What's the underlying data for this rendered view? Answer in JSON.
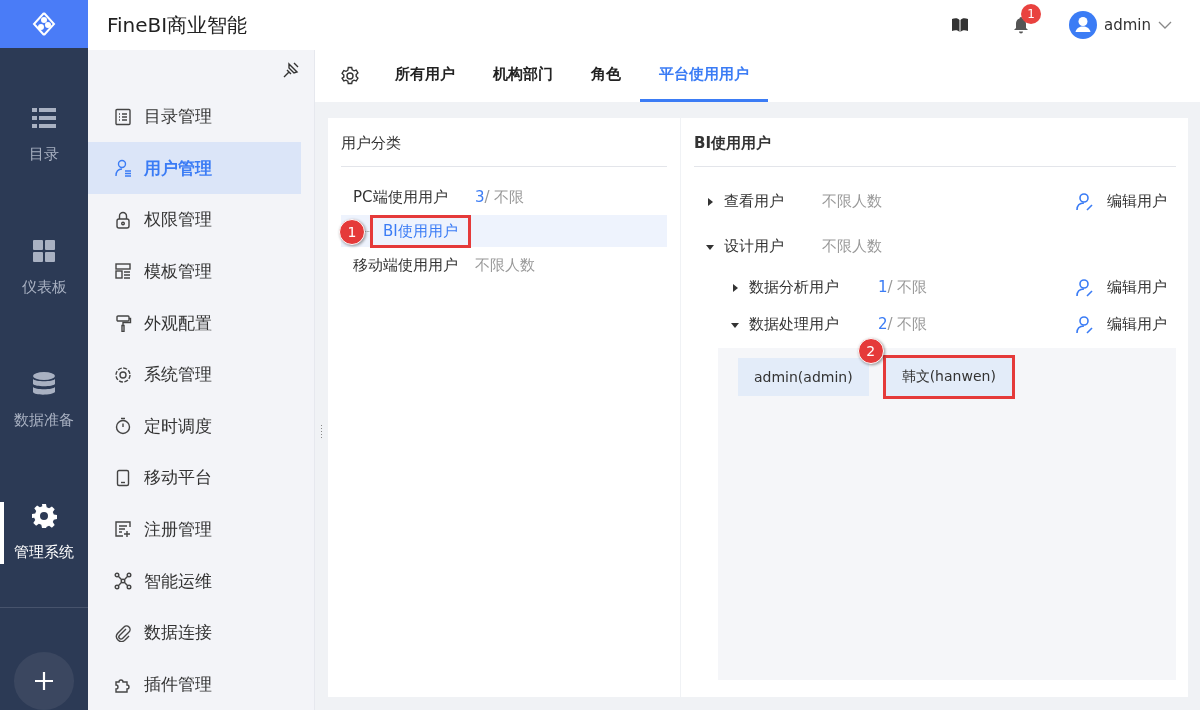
{
  "app": {
    "title": "FineBI商业智能"
  },
  "header": {
    "notifications": "1",
    "user": "admin"
  },
  "rail": [
    {
      "label": "目录",
      "selected": false
    },
    {
      "label": "仪表板",
      "selected": false
    },
    {
      "label": "数据准备",
      "selected": false
    },
    {
      "label": "管理系统",
      "selected": true
    }
  ],
  "nav": [
    {
      "label": "目录管理",
      "selected": false
    },
    {
      "label": "用户管理",
      "selected": true
    },
    {
      "label": "权限管理",
      "selected": false
    },
    {
      "label": "模板管理",
      "selected": false
    },
    {
      "label": "外观配置",
      "selected": false
    },
    {
      "label": "系统管理",
      "selected": false
    },
    {
      "label": "定时调度",
      "selected": false
    },
    {
      "label": "移动平台",
      "selected": false
    },
    {
      "label": "注册管理",
      "selected": false
    },
    {
      "label": "智能运维",
      "selected": false
    },
    {
      "label": "数据连接",
      "selected": false
    },
    {
      "label": "插件管理",
      "selected": false
    }
  ],
  "tabs": [
    {
      "label": "所有用户",
      "selected": false
    },
    {
      "label": "机构部门",
      "selected": false
    },
    {
      "label": "角色",
      "selected": false
    },
    {
      "label": "平台使用用户",
      "selected": true
    }
  ],
  "categories": {
    "title": "用户分类",
    "items": [
      {
        "label": "PC端使用用户",
        "count": "3",
        "limit": "/ 不限",
        "selected": false,
        "children": [
          {
            "label": "BI使用用户",
            "selected": true,
            "callout": "1"
          }
        ]
      },
      {
        "label": "移动端使用用户",
        "limit": "不限人数",
        "selected": false
      }
    ]
  },
  "detail": {
    "title": "BI使用用户",
    "groups": [
      {
        "label": "查看用户",
        "limit": "不限人数",
        "expanded": false,
        "action": "编辑用户"
      },
      {
        "label": "设计用户",
        "limit": "不限人数",
        "expanded": true,
        "children": [
          {
            "label": "数据分析用户",
            "count": "1",
            "limit": "/ 不限",
            "expanded": false,
            "action": "编辑用户"
          },
          {
            "label": "数据处理用户",
            "count": "2",
            "limit": "/ 不限",
            "expanded": true,
            "action": "编辑用户",
            "members": [
              {
                "label": "admin(admin)"
              },
              {
                "label": "韩文(hanwen)",
                "callout": "2"
              }
            ]
          }
        ]
      }
    ]
  }
}
